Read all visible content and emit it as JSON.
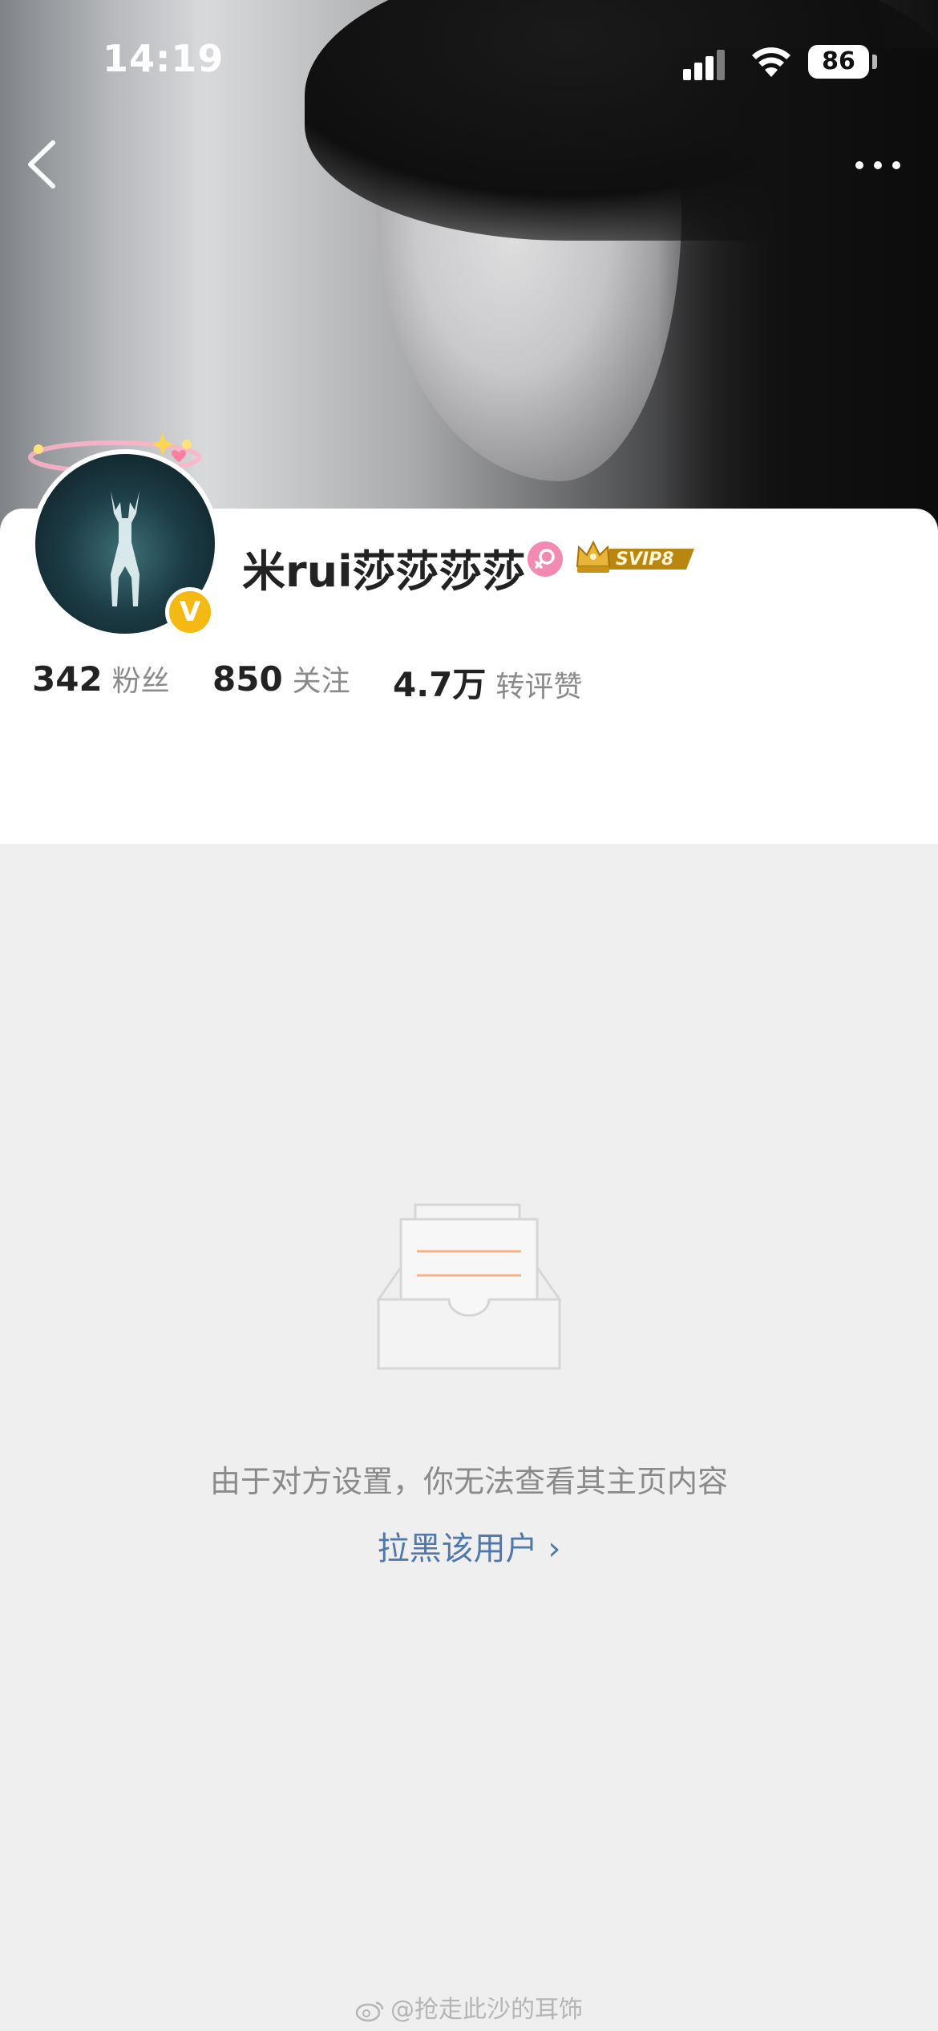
{
  "status_bar": {
    "time": "14:19",
    "battery": "86"
  },
  "profile": {
    "username": "米rui莎莎莎莎",
    "vip_badge": "SVIP8",
    "verified_badge": "V",
    "stats": [
      {
        "value": "342",
        "label": "粉丝"
      },
      {
        "value": "850",
        "label": "关注"
      },
      {
        "value": "4.7万",
        "label": "转评赞"
      }
    ]
  },
  "empty_state": {
    "message": "由于对方设置，你无法查看其主页内容",
    "action": "拉黑该用户 ›"
  },
  "watermark": "@抢走此沙的耳饰",
  "colors": {
    "link": "#4f79ad",
    "verified": "#f5b913",
    "svip_gold": "#d4a017",
    "gender_female": "#f28ab2"
  }
}
